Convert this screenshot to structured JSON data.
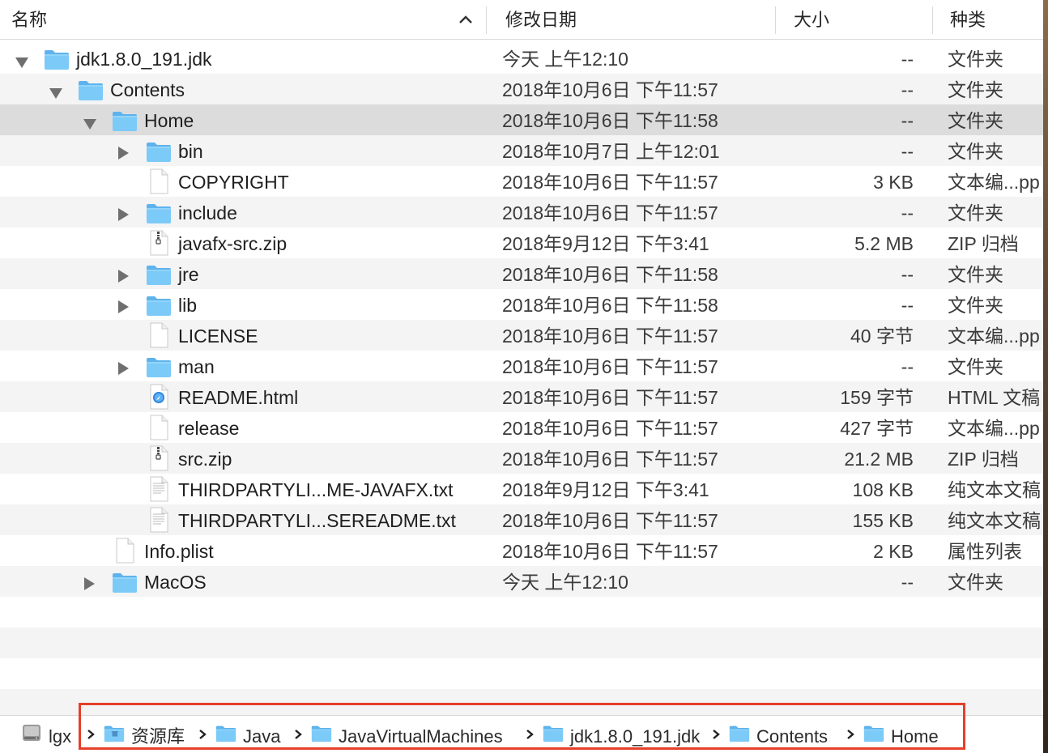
{
  "columns": {
    "name": "名称",
    "modified": "修改日期",
    "size": "大小",
    "kind": "种类"
  },
  "rows": [
    {
      "name": "jdk1.8.0_191.jdk",
      "date": "今天 上午12:10",
      "size": "--",
      "kind": "文件夹",
      "icon": "folder-icon",
      "expander": "expanded"
    },
    {
      "name": "Contents",
      "date": "2018年10月6日 下午11:57",
      "size": "--",
      "kind": "文件夹",
      "icon": "folder-icon",
      "expander": "expanded"
    },
    {
      "name": "Home",
      "date": "2018年10月6日 下午11:58",
      "size": "--",
      "kind": "文件夹",
      "icon": "folder-icon",
      "expander": "expanded"
    },
    {
      "name": "bin",
      "date": "2018年10月7日 上午12:01",
      "size": "--",
      "kind": "文件夹",
      "icon": "folder-icon",
      "expander": "collapsed"
    },
    {
      "name": "COPYRIGHT",
      "date": "2018年10月6日 下午11:57",
      "size": "3 KB",
      "kind": "文本编...pp",
      "icon": "document-icon",
      "expander": "none"
    },
    {
      "name": "include",
      "date": "2018年10月6日 下午11:57",
      "size": "--",
      "kind": "文件夹",
      "icon": "folder-icon",
      "expander": "collapsed"
    },
    {
      "name": "javafx-src.zip",
      "date": "2018年9月12日 下午3:41",
      "size": "5.2 MB",
      "kind": "ZIP 归档",
      "icon": "zip-icon",
      "expander": "none"
    },
    {
      "name": "jre",
      "date": "2018年10月6日 下午11:58",
      "size": "--",
      "kind": "文件夹",
      "icon": "folder-icon",
      "expander": "collapsed"
    },
    {
      "name": "lib",
      "date": "2018年10月6日 下午11:58",
      "size": "--",
      "kind": "文件夹",
      "icon": "folder-icon",
      "expander": "collapsed"
    },
    {
      "name": "LICENSE",
      "date": "2018年10月6日 下午11:57",
      "size": "40 字节",
      "kind": "文本编...pp",
      "icon": "document-icon",
      "expander": "none"
    },
    {
      "name": "man",
      "date": "2018年10月6日 下午11:57",
      "size": "--",
      "kind": "文件夹",
      "icon": "folder-icon",
      "expander": "collapsed"
    },
    {
      "name": "README.html",
      "date": "2018年10月6日 下午11:57",
      "size": "159 字节",
      "kind": "HTML 文稿",
      "icon": "html-icon",
      "expander": "none"
    },
    {
      "name": "release",
      "date": "2018年10月6日 下午11:57",
      "size": "427 字节",
      "kind": "文本编...pp",
      "icon": "document-icon",
      "expander": "none"
    },
    {
      "name": "src.zip",
      "date": "2018年10月6日 下午11:57",
      "size": "21.2 MB",
      "kind": "ZIP 归档",
      "icon": "zip-icon",
      "expander": "none"
    },
    {
      "name": "THIRDPARTYLI...ME-JAVAFX.txt",
      "date": "2018年9月12日 下午3:41",
      "size": "108 KB",
      "kind": "纯文本文稿",
      "icon": "text-doc-icon",
      "expander": "none"
    },
    {
      "name": "THIRDPARTYLI...SEREADME.txt",
      "date": "2018年10月6日 下午11:57",
      "size": "155 KB",
      "kind": "纯文本文稿",
      "icon": "text-doc-icon",
      "expander": "none"
    },
    {
      "name": "Info.plist",
      "date": "2018年10月6日 下午11:57",
      "size": "2 KB",
      "kind": "属性列表",
      "icon": "document-icon",
      "expander": "none"
    },
    {
      "name": "MacOS",
      "date": "今天 上午12:10",
      "size": "--",
      "kind": "文件夹",
      "icon": "folder-icon",
      "expander": "collapsed"
    }
  ],
  "selected_row": "Home",
  "pathbar": [
    {
      "label": "lgx",
      "icon": "hard-drive-icon"
    },
    {
      "label": "资源库",
      "icon": "library-folder-icon"
    },
    {
      "label": "Java",
      "icon": "folder-icon"
    },
    {
      "label": "JavaVirtualMachines",
      "icon": "folder-icon"
    },
    {
      "label": "jdk1.8.0_191.jdk",
      "icon": "folder-icon"
    },
    {
      "label": "Contents",
      "icon": "folder-icon"
    },
    {
      "label": "Home",
      "icon": "folder-icon"
    }
  ],
  "colors": {
    "folder": "#6cc3f5",
    "selected_row": "#dcdcdc",
    "stripe": "#f4f4f4",
    "highlight_box": "#e4402a"
  }
}
